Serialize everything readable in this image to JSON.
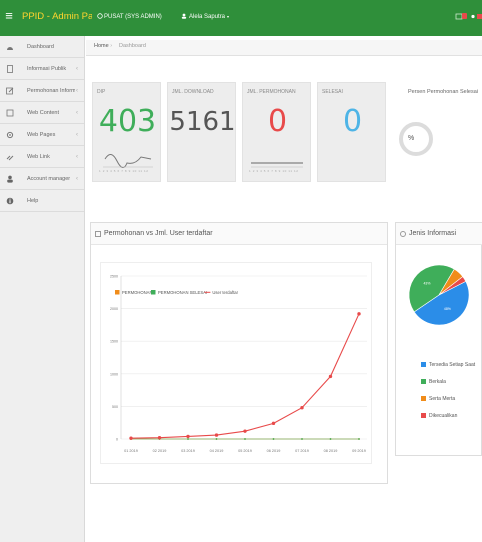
{
  "topbar": {
    "brand": "PPID - Admin Page",
    "unit": "PUSAT (SYS ADMIN)",
    "user": "Alela Saputra",
    "bg_color": "#2f8f3a",
    "brand_color": "#ffd52e"
  },
  "sidebar": {
    "items": [
      {
        "label": "Dashboard",
        "icon": "dashboard-icon",
        "chevron": ""
      },
      {
        "label": "Informasi Publik",
        "icon": "document-icon",
        "chevron": "‹"
      },
      {
        "label": "Permohonan Informasi",
        "icon": "edit-icon",
        "chevron": "‹"
      },
      {
        "label": "Web Content",
        "icon": "file-icon",
        "chevron": "‹"
      },
      {
        "label": "Web Pages",
        "icon": "gear-icon",
        "chevron": "‹"
      },
      {
        "label": "Web Link",
        "icon": "link-icon",
        "chevron": "‹"
      },
      {
        "label": "Account manager",
        "icon": "user-icon",
        "chevron": "‹"
      },
      {
        "label": "Help",
        "icon": "info-icon",
        "chevron": ""
      }
    ]
  },
  "breadcrumb": {
    "home": "Home",
    "sep": "›",
    "current": "Dashboard"
  },
  "stats": [
    {
      "title": "DIP",
      "value": "403",
      "color": "#3fae5a"
    },
    {
      "title": "JML. DOWNLOAD",
      "value": "5161",
      "color": "#555555"
    },
    {
      "title": "JML. PERMOHONAN",
      "value": "0",
      "color": "#e84a4a"
    },
    {
      "title": "SELESAI",
      "value": "0",
      "color": "#4eb4e6"
    }
  ],
  "sparkline_ticks": "1 2 3 4 5 6 7 8 9 10 11 12",
  "gauge": {
    "title": "Persen Permohonan Selesai",
    "value": "%"
  },
  "line_panel": {
    "title": "Permohonan vs Jml. User terdaftar"
  },
  "pie_panel": {
    "title": "Jenis Informasi"
  },
  "chart_data": [
    {
      "type": "line",
      "title": "Permohonan vs Jml. User terdaftar",
      "categories": [
        "01 2019",
        "02 2019",
        "03 2019",
        "04 2019",
        "05 2019",
        "06 2019",
        "07 2019",
        "08 2019",
        "09 2019"
      ],
      "y_ticks": [
        "0",
        "500",
        "1000",
        "1500",
        "2000",
        "2500"
      ],
      "ylim": [
        0,
        2500
      ],
      "grid": true,
      "legend_position": "top-left",
      "series": [
        {
          "name": "PERMOHONAN",
          "values": [
            0,
            0,
            0,
            0,
            0,
            0,
            0,
            0,
            0
          ],
          "color": "#f08c1a"
        },
        {
          "name": "PERMOHONAN SELESAI",
          "values": [
            0,
            0,
            0,
            0,
            0,
            0,
            0,
            0,
            0
          ],
          "color": "#3fae5a"
        },
        {
          "name": "User terdaftar",
          "values": [
            12,
            20,
            40,
            60,
            120,
            240,
            480,
            960,
            1920
          ],
          "color": "#e84a4a"
        }
      ]
    },
    {
      "type": "pie",
      "title": "Jenis Informasi",
      "labels": [
        "Tersedia Setiap Saat",
        "Berkala",
        "Serta Merta",
        "Dikecualikan"
      ],
      "values": [
        48,
        43,
        6,
        3
      ],
      "slice_labels": [
        "48%",
        "43%",
        "",
        ""
      ],
      "colors": [
        "#2b8de8",
        "#3fae5a",
        "#f08c1a",
        "#e84a4a"
      ],
      "legend_position": "bottom"
    }
  ]
}
